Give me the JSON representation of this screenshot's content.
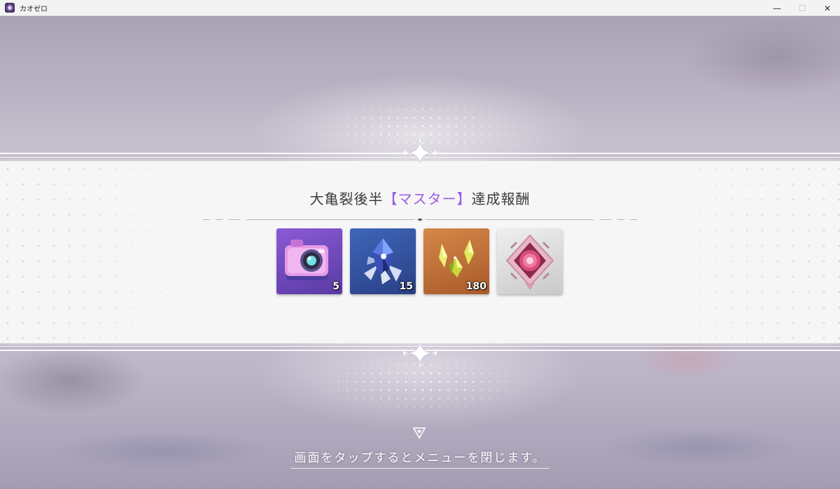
{
  "window": {
    "title": "カオゼロ",
    "minimize": "—",
    "maximize": "☐",
    "close": "✕"
  },
  "reward": {
    "title_prefix": "大亀裂後半",
    "title_accent": "【マスター】",
    "title_suffix": "達成報酬",
    "accent_color": "#9a5ce0"
  },
  "items": [
    {
      "icon": "camera-icon",
      "count": "5",
      "frame": "purple"
    },
    {
      "icon": "blue-crystal-icon",
      "count": "15",
      "frame": "blue"
    },
    {
      "icon": "gold-crystal-icon",
      "count": "180",
      "frame": "orange"
    },
    {
      "icon": "emblem-icon",
      "count": "",
      "frame": "silver"
    }
  ],
  "hint": {
    "text": "画面をタップするとメニューを閉じます。"
  }
}
